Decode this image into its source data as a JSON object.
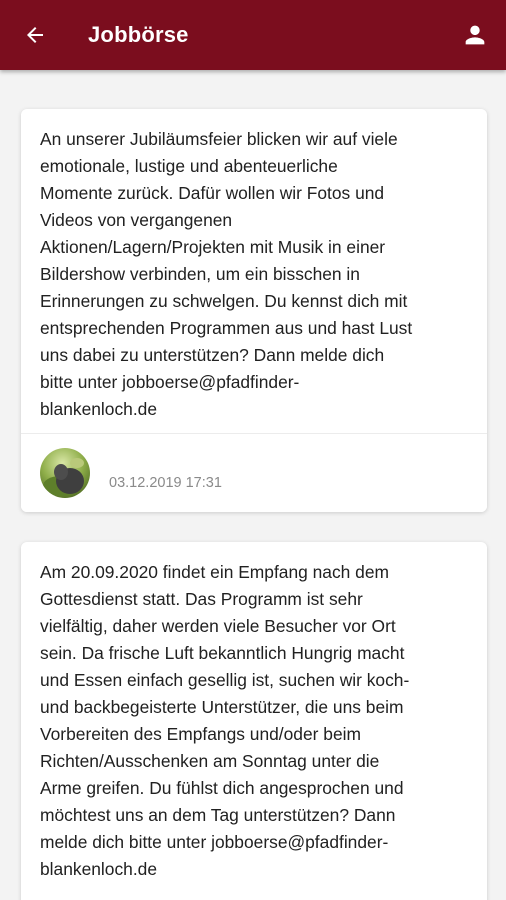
{
  "theme": {
    "primary": "#7b0d1e",
    "on_primary": "#ffffff"
  },
  "app_bar": {
    "title": "Jobbörse",
    "back_icon": "arrow-back-icon",
    "account_icon": "person-icon"
  },
  "posts": [
    {
      "text": "An unserer Jubiläumsfeier blicken wir auf viele\nemotionale, lustige und abenteuerliche\nMomente zurück. Dafür wollen wir Fotos und\nVideos von vergangenen\nAktionen/Lagern/Projekten mit Musik in einer\nBildershow verbinden, um ein bisschen in\nErinnerungen zu schwelgen. Du kennst dich mit\nentsprechenden Programmen aus und hast Lust\nuns dabei zu unterstützen? Dann melde dich\nbitte unter jobboerse@pfadfinder-\nblankenloch.de",
      "timestamp": "03.12.2019 17:31",
      "avatar_icon": "user-avatar"
    },
    {
      "text": "Am 20.09.2020 findet ein Empfang nach dem\nGottesdienst statt. Das Programm ist sehr\nvielfältig, daher werden viele Besucher vor Ort\nsein. Da frische Luft bekanntlich Hungrig macht\nund Essen einfach gesellig ist, suchen wir koch-\nund backbegeisterte Unterstützer, die uns beim\nVorbereiten des Empfangs und/oder beim\nRichten/Ausschenken am Sonntag unter die\nArme greifen. Du fühlst dich angesprochen und\nmöchtest uns an dem Tag unterstützen? Dann\nmelde dich bitte unter jobboerse@pfadfinder-\nblankenloch.de"
    }
  ]
}
